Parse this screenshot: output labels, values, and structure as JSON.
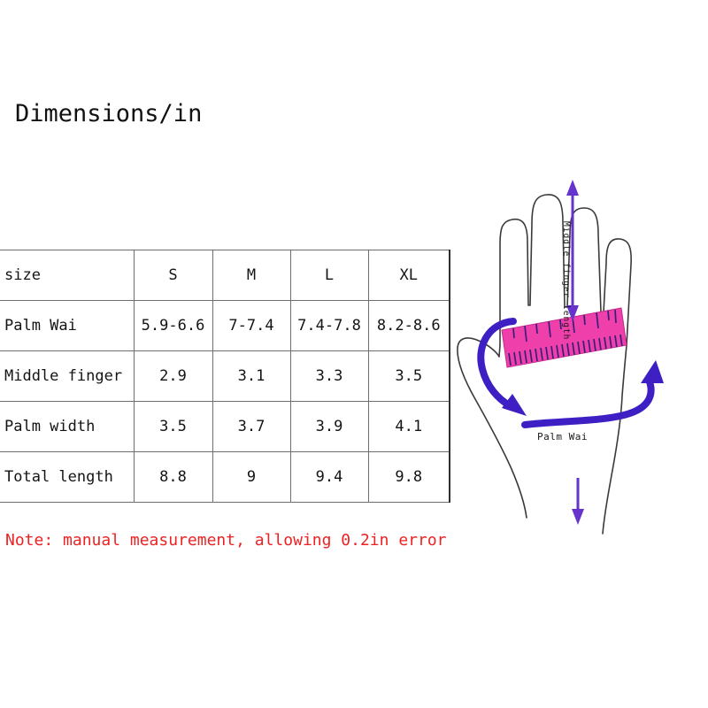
{
  "title": "Dimensions/in",
  "note": "Note: manual measurement, allowing 0.2in error",
  "colors": {
    "note_red": "#ee2222",
    "ruler_magenta": "#ee3faa",
    "ruler_tick": "#3a1f7a",
    "arrow_blue": "#3d1fc4",
    "arrow_purple": "#6633cc",
    "outline_gray": "#3a3a3a",
    "table_border": "#6d6d6d"
  },
  "table": {
    "columns": [
      "size",
      "S",
      "M",
      "L",
      "XL"
    ],
    "rows": [
      {
        "label": "Palm Wai",
        "values": [
          "5.9-6.6",
          "7-7.4",
          "7.4-7.8",
          "8.2-8.6"
        ]
      },
      {
        "label": "Middle finger",
        "values": [
          "2.9",
          "3.1",
          "3.3",
          "3.5"
        ]
      },
      {
        "label": "Palm width",
        "values": [
          "3.5",
          "3.7",
          "3.9",
          "4.1"
        ]
      },
      {
        "label": "Total length",
        "values": [
          "8.8",
          "9",
          "9.4",
          "9.8"
        ]
      }
    ]
  },
  "diagram": {
    "middle_finger_label": "Middle finger length",
    "palm_wai_label": "Palm Wai"
  }
}
